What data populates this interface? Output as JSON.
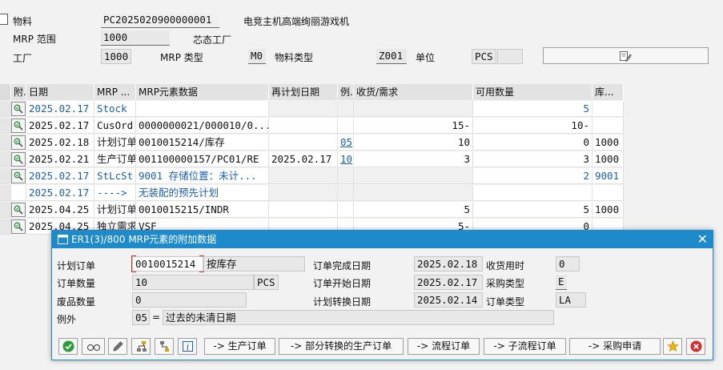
{
  "header": {
    "material_label": "物料",
    "material_value": "PC2025020900000001",
    "material_desc": "电竞主机高端绚丽游戏机",
    "mrp_area_label": "MRP 范围",
    "mrp_area_value": "1000",
    "mrp_area_desc": "芯态工厂",
    "plant_label": "工厂",
    "plant_value": "1000",
    "mrp_type_label": "MRP 类型",
    "mrp_type_value": "M0",
    "material_type_label": "物料类型",
    "material_type_value": "Z001",
    "unit_label": "单位",
    "unit_value": "PCS",
    "unit_extra": ""
  },
  "grid": {
    "columns": [
      "附.",
      "日期",
      "MRP ...",
      "MRP元素数据",
      "再计划日期",
      "例.",
      "收货/需求",
      "可用数量",
      "库..."
    ],
    "rows": [
      {
        "date": "2025.02.17",
        "mrp": "Stock",
        "data": "",
        "resched": "",
        "exc": "",
        "qty": "",
        "avail": "5",
        "stor": "",
        "style": "blue"
      },
      {
        "date": "2025.02.17",
        "mrp": "CusOrd",
        "data": "0000000021/000010/0...",
        "resched": "",
        "exc": "",
        "qty": "15-",
        "avail": "10-",
        "stor": "",
        "style": "normal"
      },
      {
        "date": "2025.02.18",
        "mrp": "计划订单",
        "data": "0010015214/库存",
        "resched": "",
        "exc": "05",
        "qty": "10",
        "avail": "0",
        "stor": "1000",
        "style": "normal"
      },
      {
        "date": "2025.02.21",
        "mrp": "生产订单",
        "data": "001100000157/PC01/RE",
        "resched": "2025.02.17",
        "exc": "10",
        "qty": "3",
        "avail": "3",
        "stor": "1000",
        "style": "normal"
      },
      {
        "date": "2025.02.17",
        "mrp": "StLcSt",
        "data": "9001 存储位置：未计...",
        "resched": "",
        "exc": "",
        "qty": "",
        "avail": "2",
        "stor": "9001",
        "style": "blue"
      },
      {
        "date": "2025.02.17",
        "mrp": "---->",
        "data": "无装配的预先计划",
        "resched": "",
        "exc": "",
        "qty": "",
        "avail": "",
        "stor": "",
        "style": "blue-noicon"
      },
      {
        "date": "2025.04.25",
        "mrp": "计划订单",
        "data": "0010015215/INDR",
        "resched": "",
        "exc": "",
        "qty": "5",
        "avail": "5",
        "stor": "1000",
        "style": "normal"
      },
      {
        "date": "2025.04.25",
        "mrp": "独立需求",
        "data": "VSF",
        "resched": "",
        "exc": "",
        "qty": "5-",
        "avail": "0",
        "stor": "",
        "style": "normal"
      }
    ]
  },
  "dialog": {
    "title": "ER1(3)/800 MRP元素的附加数据",
    "plan_order_label": "计划订单",
    "plan_order_value": "0010015214",
    "plan_order_desc": "按库存",
    "order_qty_label": "订单数量",
    "order_qty_value": "10",
    "order_qty_unit": "PCS",
    "scrap_qty_label": "废品数量",
    "scrap_qty_value": "0",
    "exception_label": "例外",
    "exception_code": "05",
    "exception_eq": "=",
    "exception_text": "过去的未清日期",
    "finish_date_label": "订单完成日期",
    "finish_date_value": "2025.02.18",
    "gr_time_label": "收货用时",
    "gr_time_value": "0",
    "start_date_label": "订单开始日期",
    "start_date_value": "2025.02.17",
    "proc_type_label": "采购类型",
    "proc_type_value": "E",
    "conv_date_label": "计划转换日期",
    "conv_date_value": "2025.02.14",
    "order_type_label": "订单类型",
    "order_type_value": "LA",
    "buttons": {
      "to_prod_order": "-> 生产订单",
      "to_partial_prod": "-> 部分转换的生产订单",
      "to_process_order": "-> 流程订单",
      "to_sub_process": "-> 子流程订单",
      "to_purch_req": "-> 采购申请"
    }
  },
  "colors": {
    "accent": "#1d8acb",
    "link": "#1a5fb4",
    "confirm": "#2a9d3a",
    "cancel": "#d32f2f",
    "favorite": "#f0b400"
  }
}
